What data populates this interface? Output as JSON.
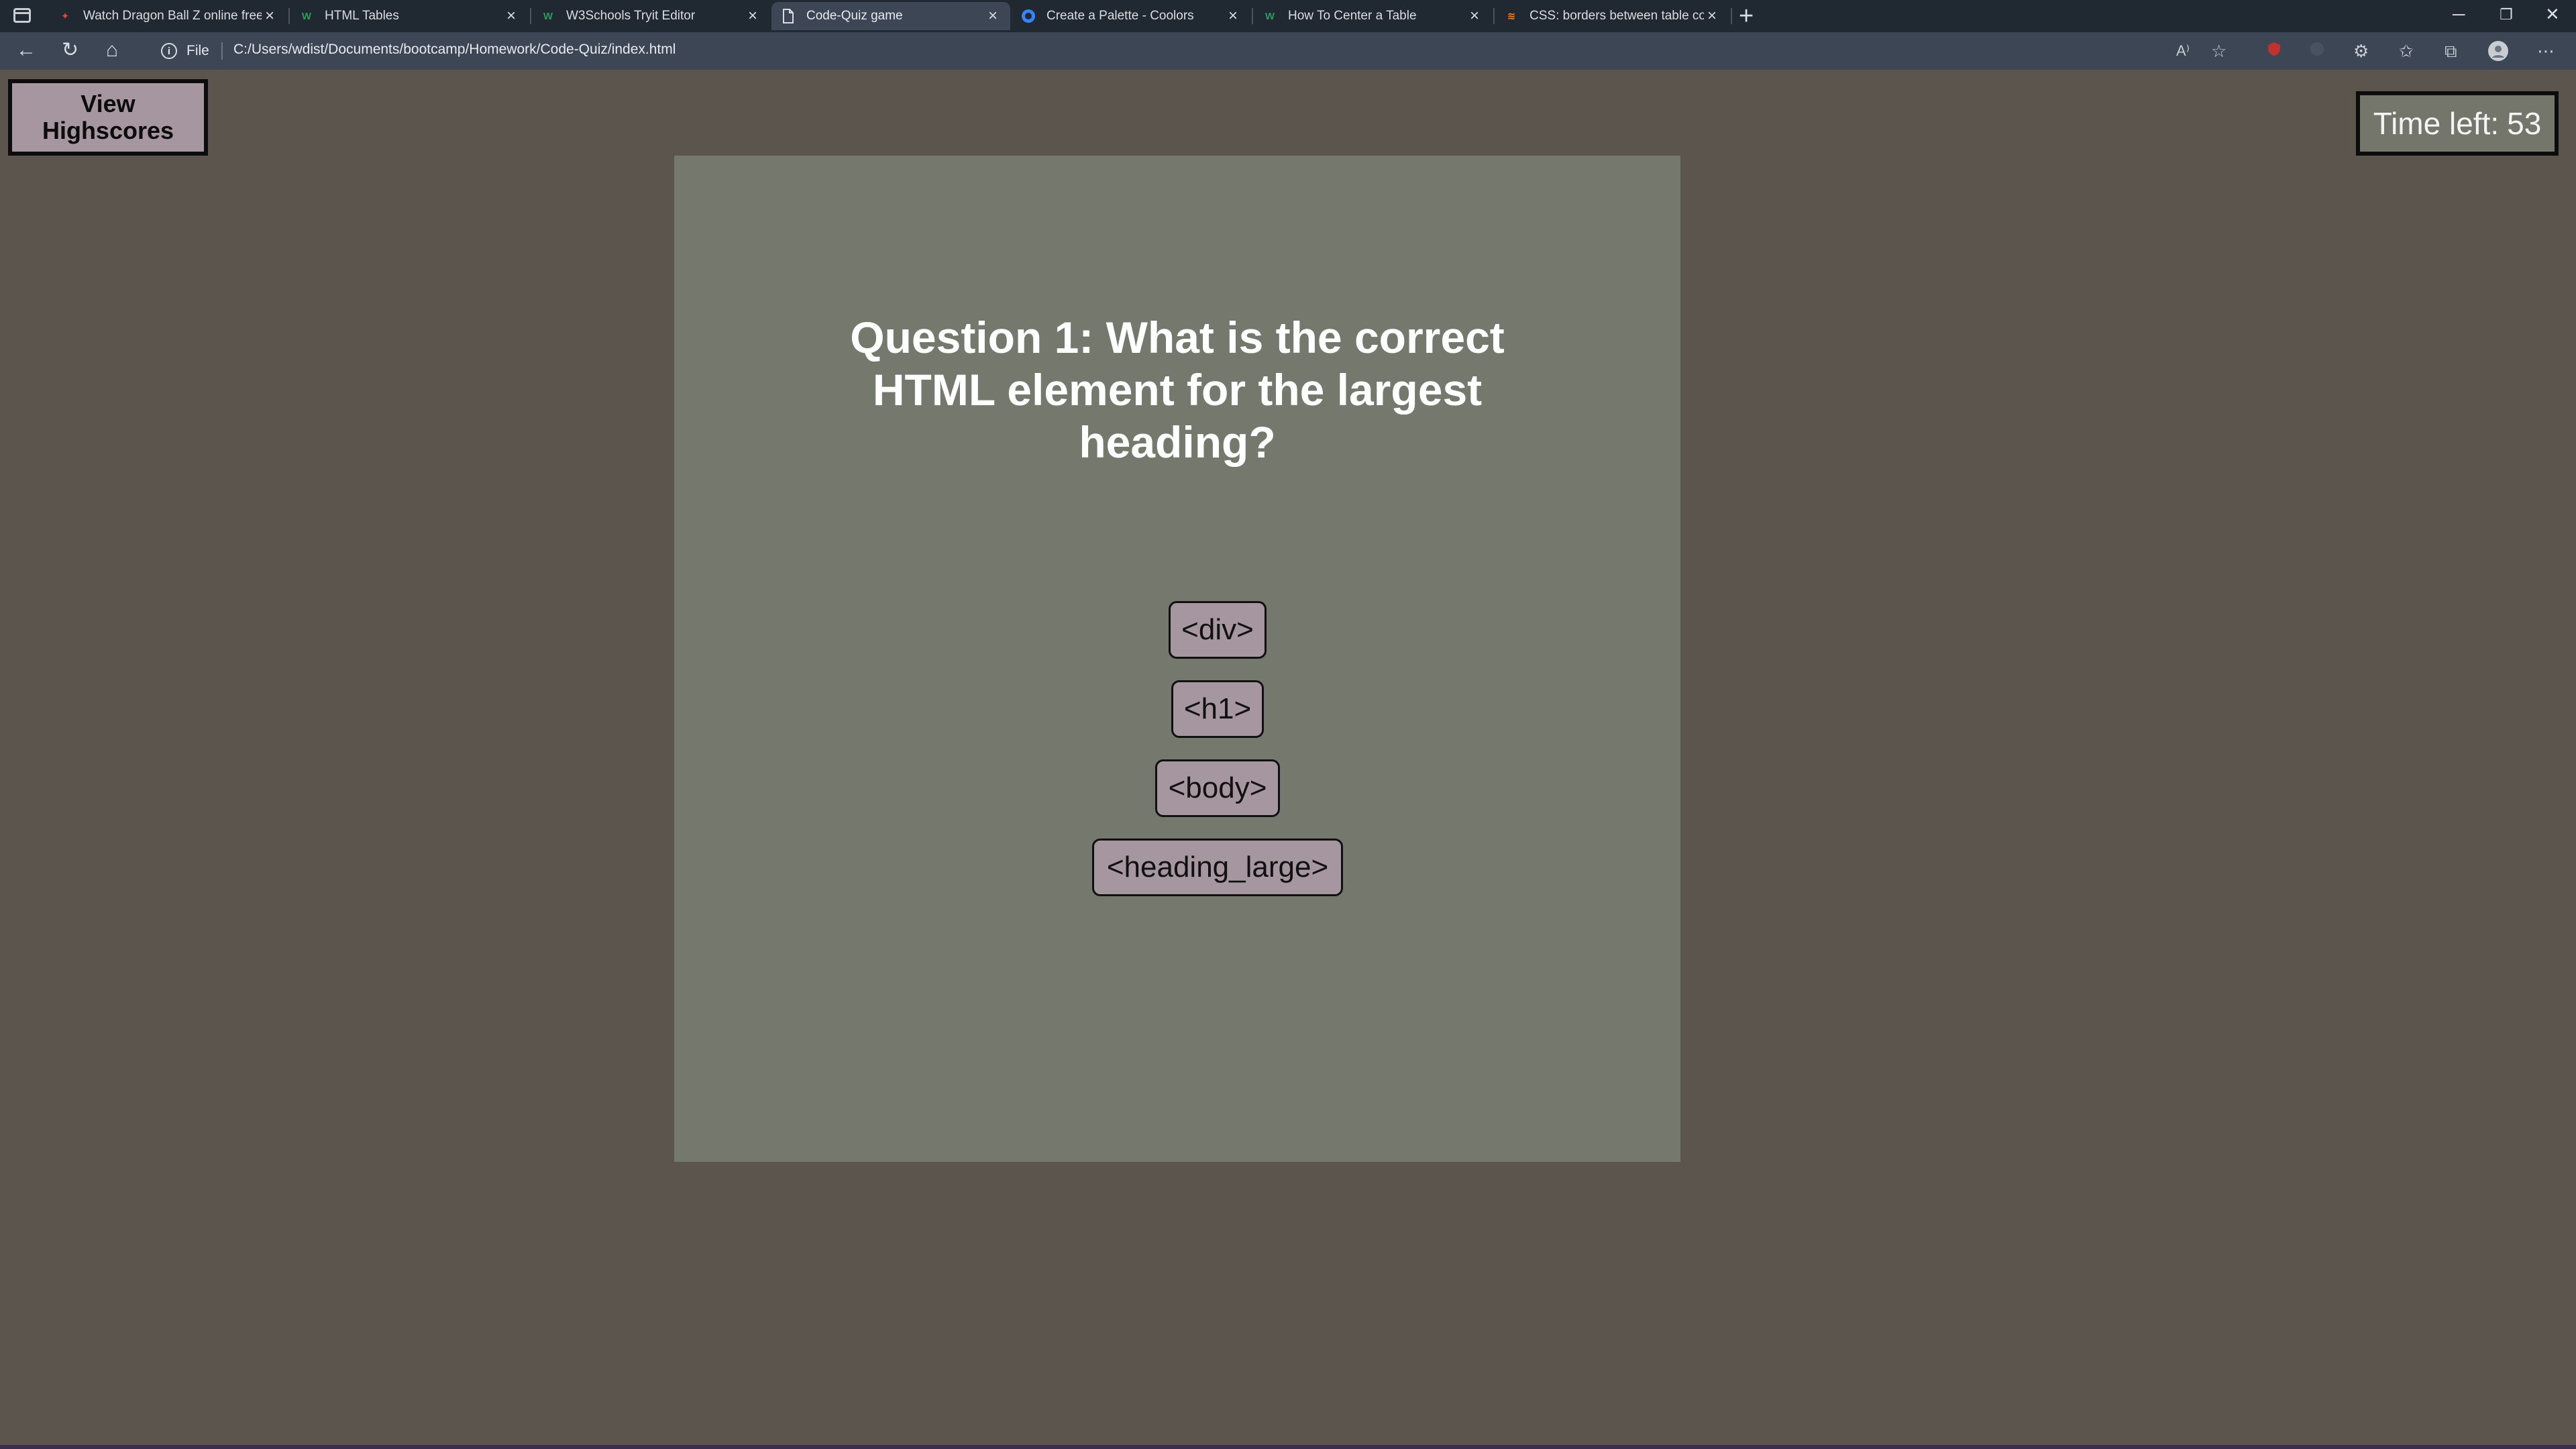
{
  "browser": {
    "tabs": [
      {
        "title": "Watch Dragon Ball Z online free",
        "favicon": "red-logo-icon",
        "active": false
      },
      {
        "title": "HTML Tables",
        "favicon": "w3schools-icon",
        "active": false
      },
      {
        "title": "W3Schools Tryit Editor",
        "favicon": "w3schools-icon",
        "active": false
      },
      {
        "title": "Code-Quiz game",
        "favicon": "page-icon",
        "active": true
      },
      {
        "title": "Create a Palette - Coolors",
        "favicon": "coolors-icon",
        "active": false
      },
      {
        "title": "How To Center a Table",
        "favicon": "w3schools-icon",
        "active": false
      },
      {
        "title": "CSS: borders between table colu",
        "favicon": "stackoverflow-icon",
        "active": false
      }
    ],
    "address": {
      "scheme_label": "File",
      "url": "C:/Users/wdist/Documents/bootcamp/Homework/Code-Quiz/index.html"
    }
  },
  "page": {
    "highscores_label": "View Highscores",
    "timer_label": "Time left:",
    "timer_value": "53",
    "question": "Question 1: What is the correct HTML element for the largest heading?",
    "answers": [
      "<div>",
      "<h1>",
      "<body>",
      "<heading_large>"
    ]
  },
  "colors": {
    "page_background": "#5b554d",
    "card_background": "#74786d",
    "button_background": "#a596a0",
    "timer_background": "#74766c"
  }
}
